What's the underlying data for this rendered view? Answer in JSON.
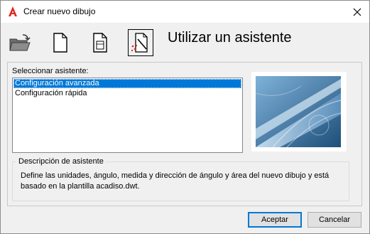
{
  "window": {
    "title": "Crear nuevo dibujo"
  },
  "toolbar": {
    "modes": [
      {
        "icon": "open-folder-icon",
        "selected": false
      },
      {
        "icon": "blank-document-icon",
        "selected": false
      },
      {
        "icon": "template-document-icon",
        "selected": false
      },
      {
        "icon": "wizard-icon",
        "selected": true
      }
    ]
  },
  "main": {
    "heading": "Utilizar un asistente",
    "select_label": "Seleccionar asistente:",
    "wizards": [
      {
        "label": "Configuración avanzada",
        "selected": true
      },
      {
        "label": "Configuración rápida",
        "selected": false
      }
    ]
  },
  "description": {
    "legend": "Descripción de asistente",
    "text": "Define las unidades, ángulo, medida y dirección de ángulo y área del nuevo dibujo y está basado en la plantilla acadiso.dwt."
  },
  "buttons": {
    "accept": "Aceptar",
    "cancel": "Cancelar"
  },
  "colors": {
    "selection": "#0078d7",
    "accent": "#e1261c"
  }
}
